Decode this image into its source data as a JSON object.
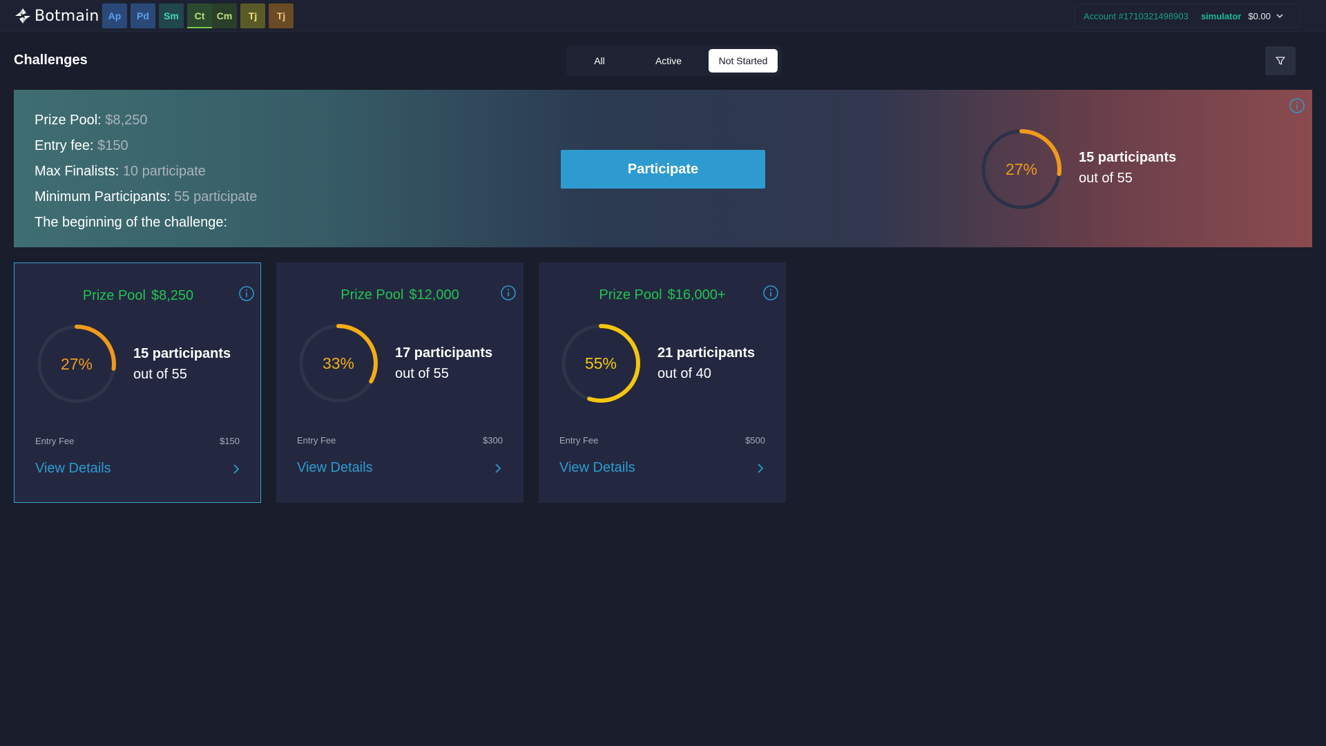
{
  "brand": {
    "name": "Botmain"
  },
  "apps": [
    {
      "label": "Ap",
      "bg": "#2b4978",
      "fg": "#5aa0ee"
    },
    {
      "label": "Pd",
      "bg": "#2b4978",
      "fg": "#5aa0ee"
    },
    {
      "label": "Sm",
      "bg": "#21464b",
      "fg": "#4ad5b4"
    },
    {
      "label": "Ct",
      "bg": "#2a4a2f",
      "fg": "#b9e07f",
      "active": true
    },
    {
      "label": "Cm",
      "bg": "#2a3f29",
      "fg": "#b9e07f"
    },
    {
      "label": "Tj",
      "bg": "#5a5a26",
      "fg": "#f1e57c"
    },
    {
      "label": "Tj",
      "bg": "#6a4b25",
      "fg": "#f4c27a"
    }
  ],
  "account": {
    "id": "Account #1710321498903",
    "mode": "simulator",
    "balance": "$0.00"
  },
  "page": {
    "title": "Challenges"
  },
  "filters": {
    "tabs": [
      "All",
      "Active",
      "Not Started"
    ],
    "selected": "Not Started"
  },
  "hero": {
    "prize_pool_label": "Prize Pool:",
    "prize_pool_value": "$8,250",
    "entry_fee_label": "Entry fee:",
    "entry_fee_value": "$150",
    "max_finalists_label": "Max Finalists:",
    "max_finalists_value": "10 participate",
    "min_participants_label": "Minimum Participants:",
    "min_participants_value": "55 participate",
    "beginning_label": "The beginning of the challenge:",
    "participate_label": "Participate",
    "percent": 27,
    "percent_label": "27%",
    "participants_line1": "15 participants",
    "participants_line2": "out of 55",
    "ring_color": "#f09a1c"
  },
  "cards": [
    {
      "prize_label": "Prize Pool",
      "prize_value": "$8,250",
      "percent": 27,
      "percent_label": "27%",
      "ring_color": "#f09a1c",
      "participants_line1": "15 participants",
      "participants_line2": "out of 55",
      "entry_fee_label": "Entry Fee",
      "entry_fee_value": "$150",
      "view_details": "View Details",
      "selected": true
    },
    {
      "prize_label": "Prize Pool",
      "prize_value": "$12,000",
      "percent": 33,
      "percent_label": "33%",
      "ring_color": "#f3ad15",
      "participants_line1": "17 participants",
      "participants_line2": "out of 55",
      "entry_fee_label": "Entry Fee",
      "entry_fee_value": "$300",
      "view_details": "View Details",
      "selected": false
    },
    {
      "prize_label": "Prize Pool",
      "prize_value": "$16,000+",
      "percent": 55,
      "percent_label": "55%",
      "ring_color": "#f5c60e",
      "participants_line1": "21 participants",
      "participants_line2": "out of 40",
      "entry_fee_label": "Entry Fee",
      "entry_fee_value": "$500",
      "view_details": "View Details",
      "selected": false
    }
  ]
}
